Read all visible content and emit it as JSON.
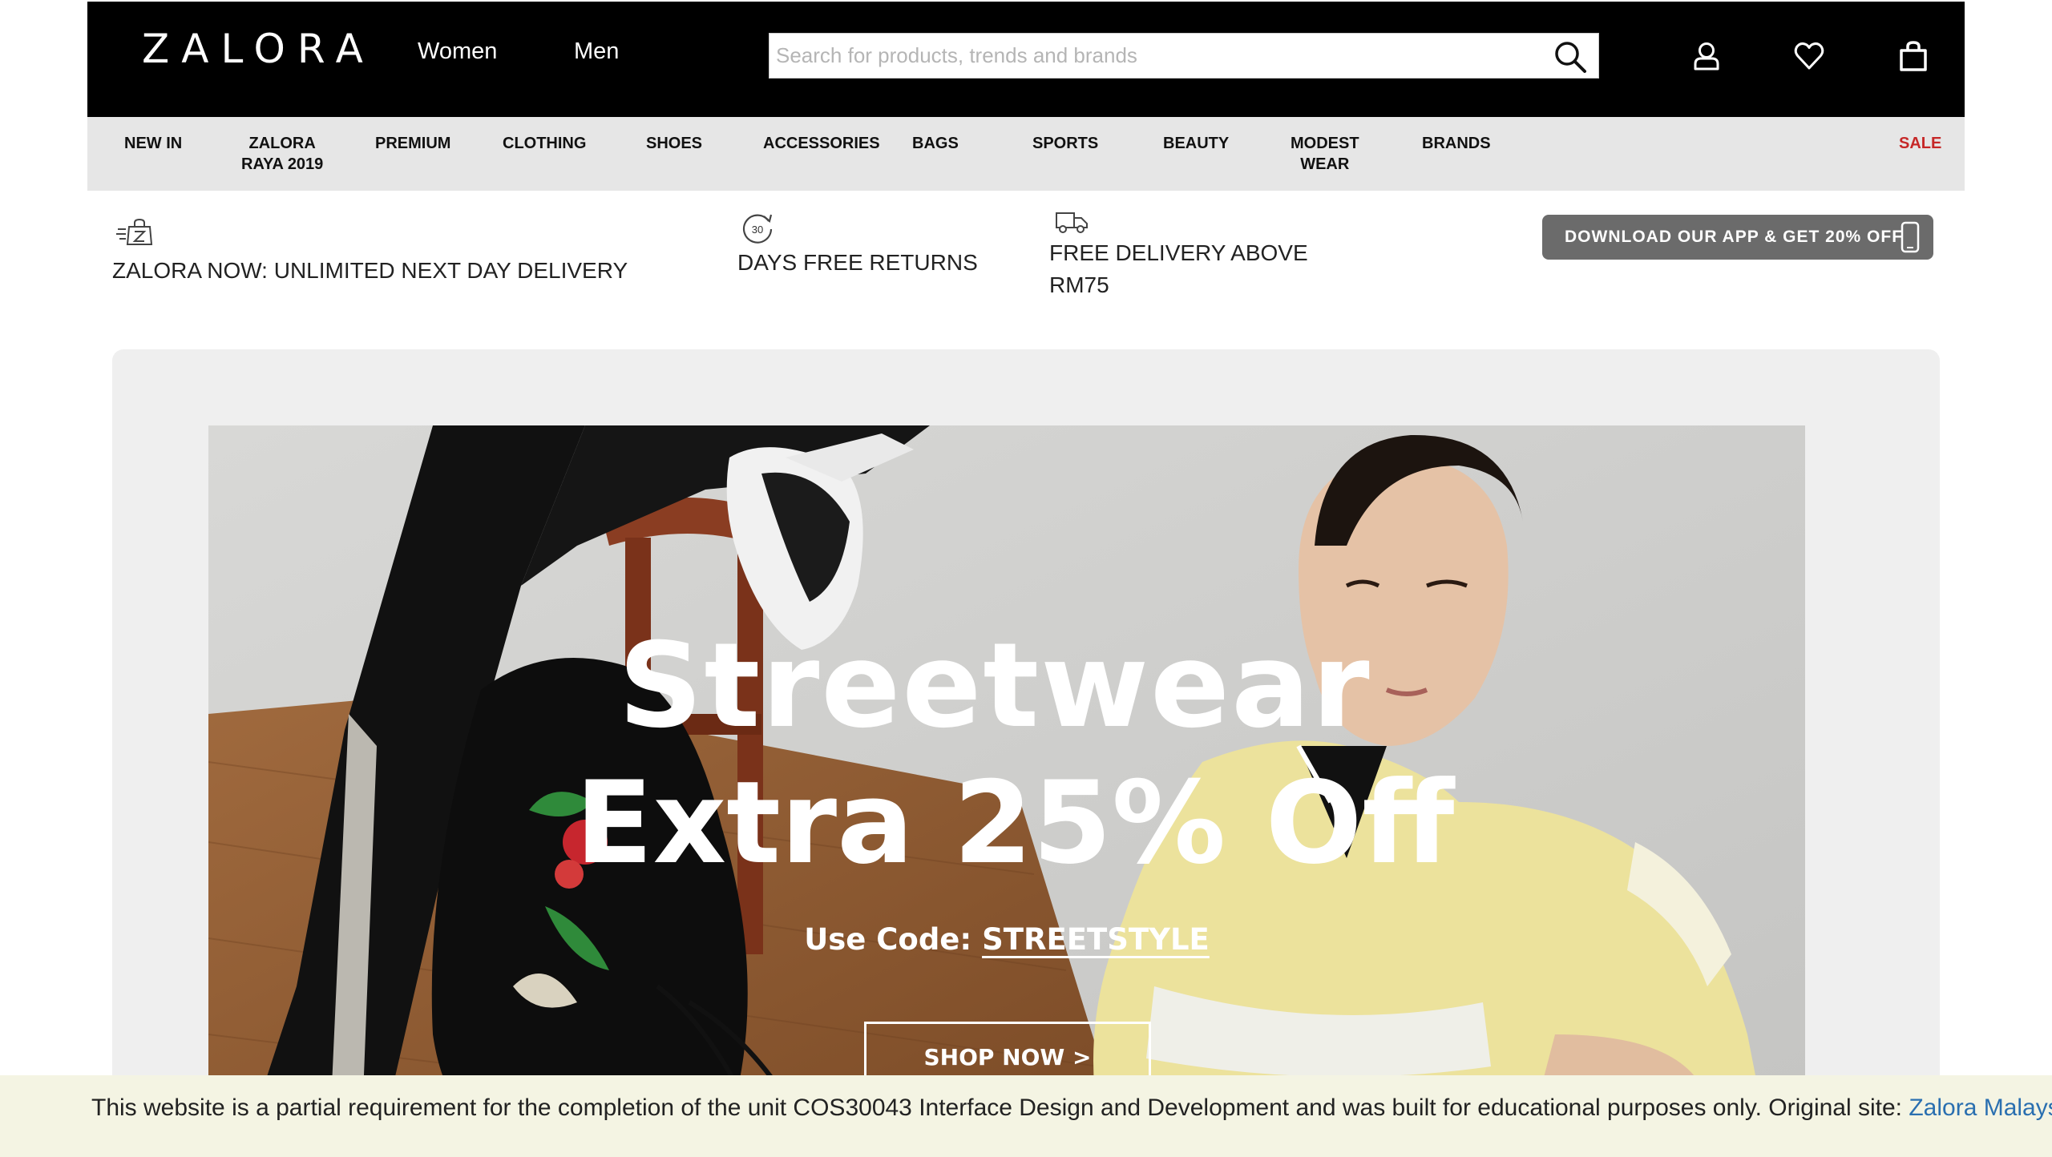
{
  "header": {
    "logo": "ZALORA",
    "gender_links": [
      "Women",
      "Men"
    ],
    "search": {
      "placeholder": "Search for products, trends and brands",
      "value": ""
    },
    "icons": [
      "search-icon",
      "account-icon",
      "wishlist-icon",
      "bag-icon"
    ]
  },
  "categories": [
    "NEW IN",
    "ZALORA\nRAYA 2019",
    "PREMIUM",
    "CLOTHING",
    "SHOES",
    "ACCESSORIES",
    "BAGS",
    "SPORTS",
    "BEAUTY",
    "MODEST\nWEAR",
    "BRANDS",
    "SALE"
  ],
  "usp": {
    "next_day": "ZALORA NOW: UNLIMITED NEXT DAY DELIVERY",
    "returns_badge": "30",
    "returns": "DAYS FREE RETURNS",
    "free_delivery_line1": "FREE DELIVERY ABOVE",
    "free_delivery_line2": "RM75",
    "app_button": "DOWNLOAD OUR APP & GET 20% OFF"
  },
  "hero": {
    "title": "Streetwear",
    "subtitle": "Extra 25% Off",
    "code_label": "Use Code:",
    "code_value": "STREETSTYLE",
    "cta": "SHOP NOW >"
  },
  "notice": {
    "text": "This website is a partial requirement for the completion of the unit COS30043 Interface Design and Development and was built for educational purposes only. Original site: ",
    "link": "Zalora Malaysia"
  },
  "colors": {
    "header_bg": "#000000",
    "nav_bg": "#e6e6e6",
    "sale": "#c62828",
    "app_button_bg": "#6b6b6b",
    "notice_bg": "#f4f4e3",
    "link": "#2a6fb0"
  }
}
